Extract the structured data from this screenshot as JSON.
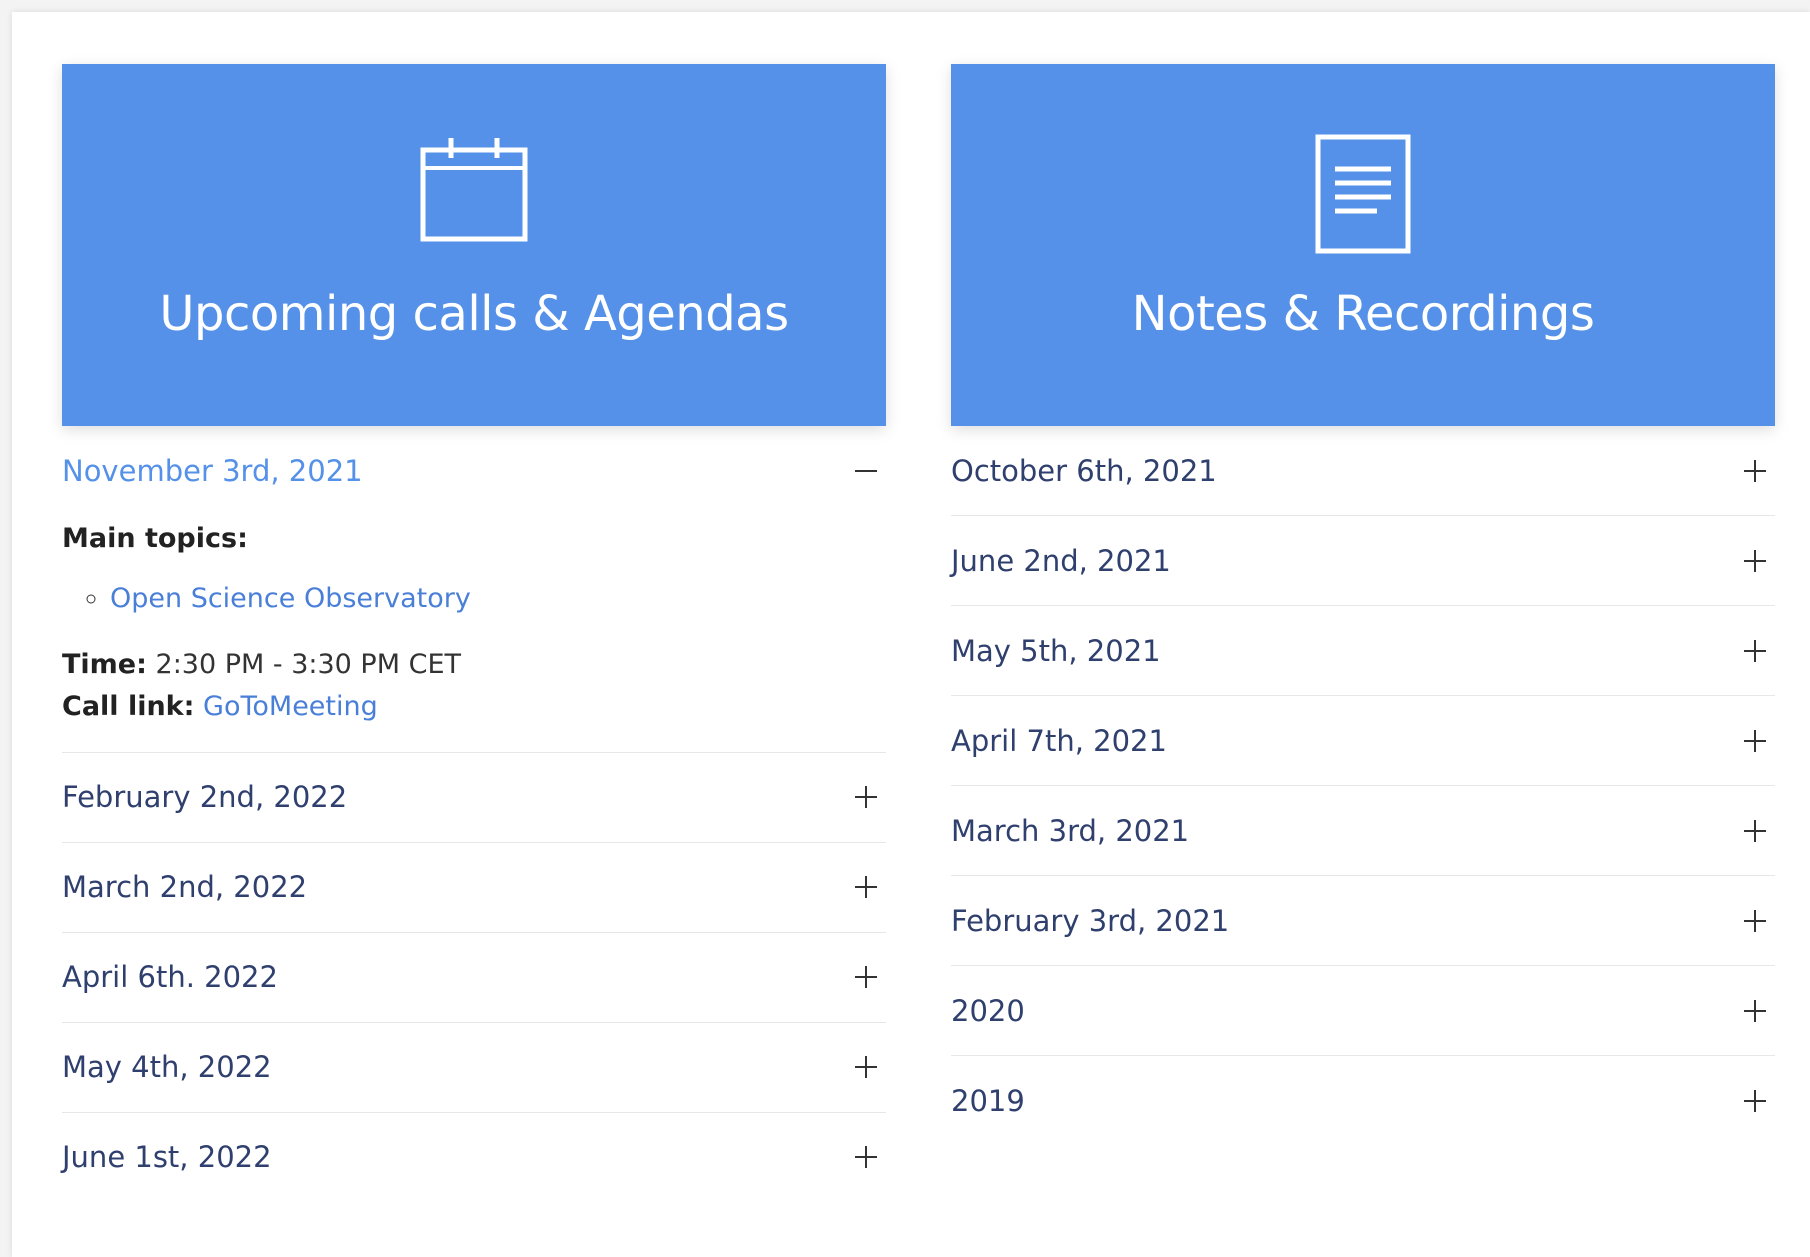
{
  "upcoming": {
    "title": "Upcoming calls & Agendas",
    "icon": "calendar-icon",
    "open_item": {
      "label": "November 3rd, 2021",
      "toggle": "minus-icon",
      "main_topics_label": "Main topics:",
      "topics": [
        "Open Science Observatory"
      ],
      "time_label": "Time:",
      "time_value": "2:30 PM - 3:30 PM CET",
      "call_link_label": "Call link:",
      "call_link_text": "GoToMeeting"
    },
    "items": [
      {
        "label": "February 2nd, 2022"
      },
      {
        "label": "March 2nd, 2022"
      },
      {
        "label": "April 6th. 2022"
      },
      {
        "label": "May 4th, 2022"
      },
      {
        "label": "June 1st, 2022"
      }
    ]
  },
  "notes": {
    "title": "Notes & Recordings",
    "icon": "document-icon",
    "items": [
      {
        "label": "October 6th, 2021"
      },
      {
        "label": "June 2nd, 2021"
      },
      {
        "label": "May 5th, 2021"
      },
      {
        "label": "April 7th, 2021"
      },
      {
        "label": "March 3rd, 2021"
      },
      {
        "label": "February 3rd, 2021"
      },
      {
        "label": "2020"
      },
      {
        "label": "2019"
      }
    ]
  },
  "colors": {
    "banner": "#5591e8",
    "link": "#4a7fd8",
    "item_text": "#2f3f6e"
  }
}
